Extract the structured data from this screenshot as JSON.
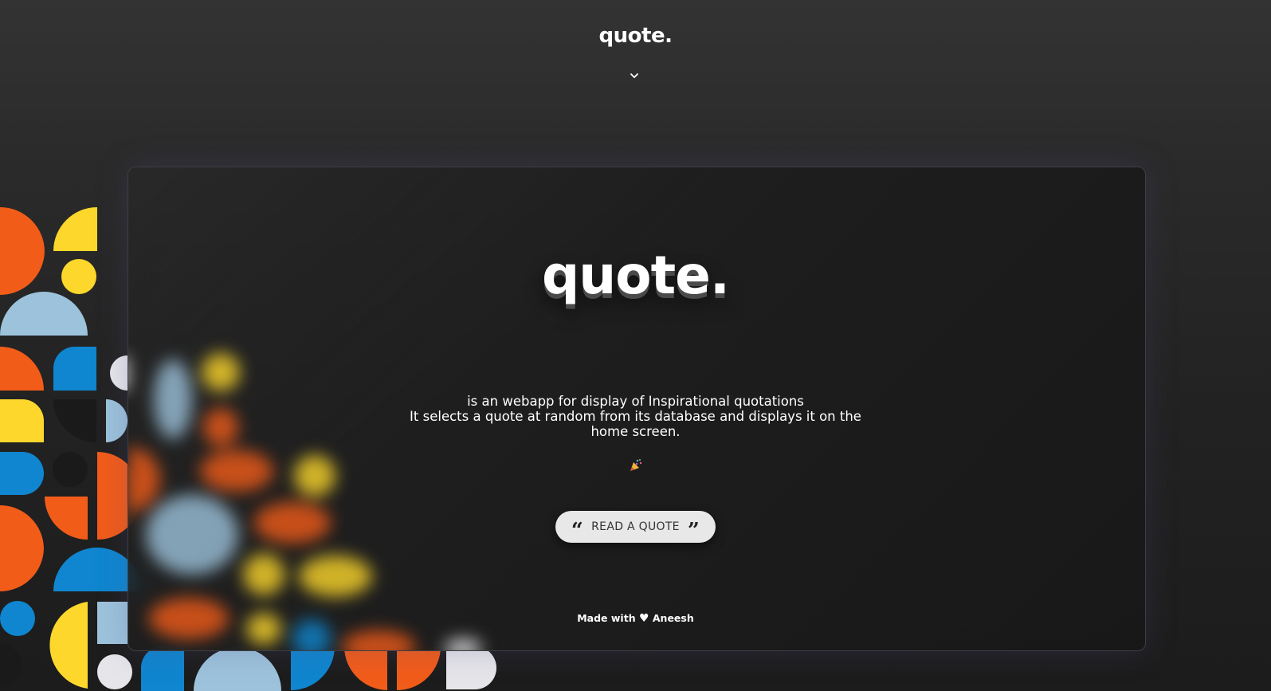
{
  "header": {
    "logo": "quote.",
    "chevron_icon": "chevron-down-icon"
  },
  "hero": {
    "title": "quote.",
    "description_lines": [
      "is an webapp for display of Inspirational quotations",
      "It selects a quote at random from its database and displays it on the",
      "home screen."
    ],
    "emoji_icon": "party-popper-icon"
  },
  "cta": {
    "label": "READ A QUOTE",
    "left_icon": "open-quote-icon",
    "right_icon": "close-quote-icon",
    "open_quote_glyph": "“",
    "close_quote_glyph": "”"
  },
  "footer": {
    "prefix": "Made with",
    "author": "Aneesh",
    "heart_glyph": "♥"
  },
  "colors": {
    "orange": "#f25c19",
    "yellow": "#fdd72b",
    "light_blue": "#9dc3dc",
    "blue": "#0f86cf",
    "white": "#e6e6ea",
    "black": "#1a1a1a"
  }
}
